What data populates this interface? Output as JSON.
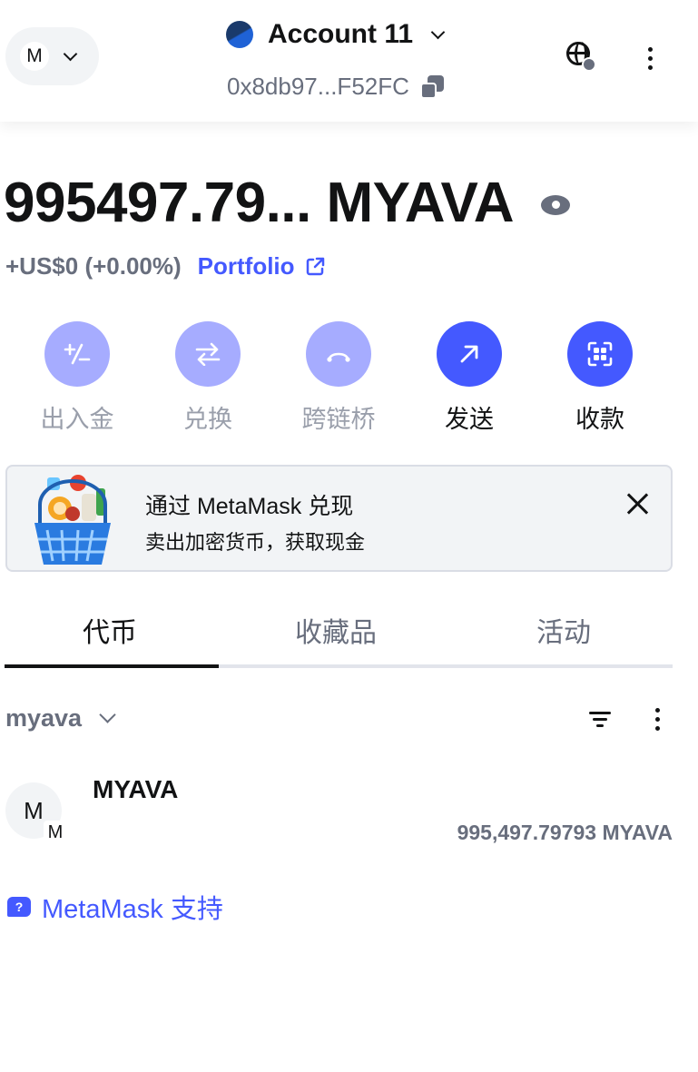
{
  "header": {
    "network_avatar_letter": "M",
    "network_picker_icon": "chevron-down-icon",
    "account_name": "Account 11",
    "address": "0x8db97...F52FC",
    "copy_icon": "copy-icon",
    "globe_icon": "globe-icon",
    "menu_icon": "kebab-icon"
  },
  "balance": {
    "amount": "995497.79... MYAVA",
    "visibility_icon": "eye-icon",
    "change": "+US$0 (+0.00%)",
    "portfolio_label": "Portfolio",
    "portfolio_icon": "external-link-icon"
  },
  "actions": [
    {
      "label": "出入金",
      "icon": "buy-sell-icon",
      "state": "disabled"
    },
    {
      "label": "兑换",
      "icon": "swap-icon",
      "state": "disabled"
    },
    {
      "label": "跨链桥",
      "icon": "bridge-icon",
      "state": "disabled"
    },
    {
      "label": "发送",
      "icon": "send-arrow-icon",
      "state": "active"
    },
    {
      "label": "收款",
      "icon": "qr-scan-icon",
      "state": "active"
    }
  ],
  "banner": {
    "title": "通过 MetaMask 兑现",
    "subtitle": "卖出加密货币，获取现金",
    "art": "shopping-basket-icon",
    "close_icon": "close-icon"
  },
  "tabs": [
    {
      "label": "代币",
      "selected": true
    },
    {
      "label": "收藏品",
      "selected": false
    },
    {
      "label": "活动",
      "selected": false
    }
  ],
  "filter": {
    "network_label": "myava",
    "sort_icon": "filter-icon",
    "more_icon": "kebab-icon"
  },
  "tokens": [
    {
      "name": "MYAVA",
      "avatar_letter": "M",
      "network_badge_letter": "M",
      "balance": "995,497.79793 MYAVA"
    }
  ],
  "support": {
    "label": "MetaMask 支持",
    "icon": "help-chat-icon"
  },
  "colors": {
    "primary": "#4459ff",
    "primary_disabled": "#a6acff",
    "muted_text": "#686e7d",
    "text": "#121314",
    "banner_bg": "#f2f4f6"
  }
}
